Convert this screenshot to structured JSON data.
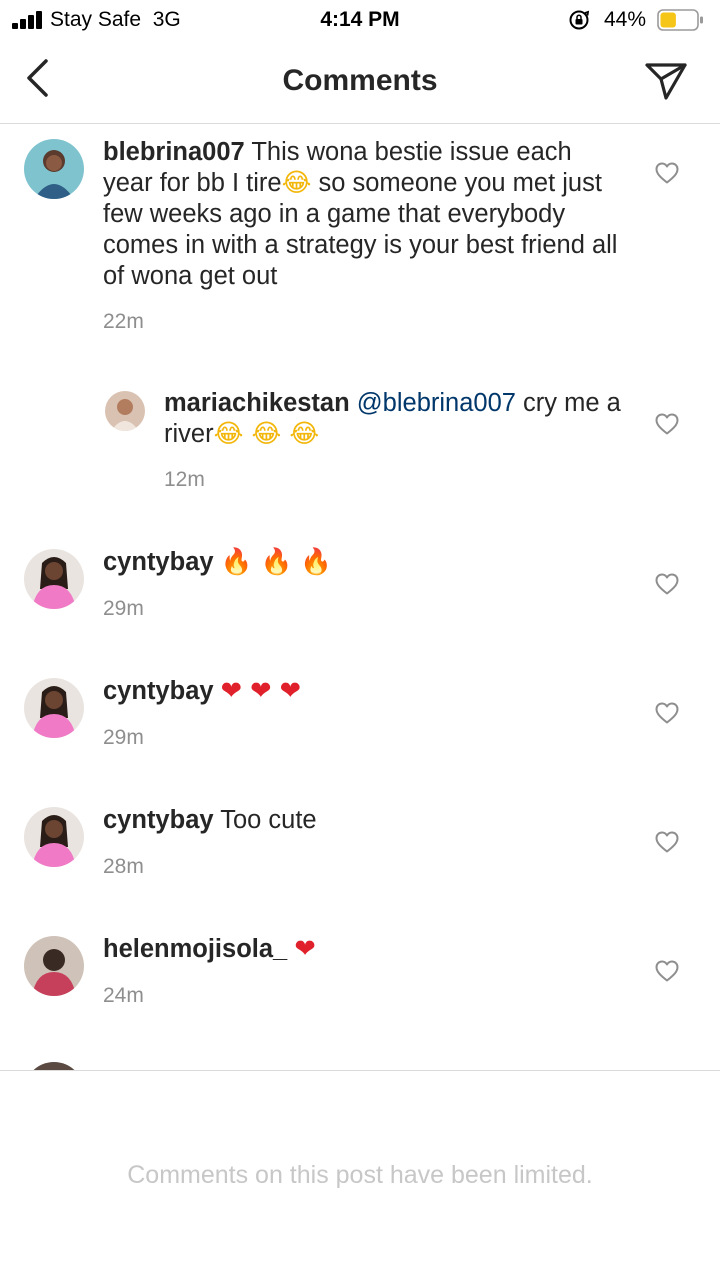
{
  "status_bar": {
    "carrier": "Stay Safe  3G",
    "time": "4:14 PM",
    "battery_percent": "44%",
    "battery_level": 0.44
  },
  "header": {
    "title": "Comments",
    "back_icon": "chevron-left-icon",
    "send_icon": "paper-plane-icon"
  },
  "comments": [
    {
      "username": "blebrina007",
      "text_1": "This wona bestie issue each year for bb I tire",
      "emoji_1": "😂",
      "text_2": " so someone you met just few weeks ago in a game that everybody comes in with a strategy is your best friend all of wona get out",
      "time": "22m"
    },
    {
      "username": "mariachikestan",
      "mention": "@blebrina007",
      "text_1": " cry me a river",
      "emojis": "😂 😂 😂",
      "time": "12m"
    },
    {
      "username": "cyntybay",
      "emojis": "🔥 🔥 🔥",
      "time": "29m"
    },
    {
      "username": "cyntybay",
      "emojis": "❤ ❤ ❤",
      "time": "29m"
    },
    {
      "username": "cyntybay",
      "text": "Too cute",
      "time": "28m"
    },
    {
      "username": "helenmojisola_",
      "emojis": "❤",
      "time": "24m"
    }
  ],
  "footer": {
    "note": "Comments on this post have been limited."
  },
  "colors": {
    "text": "#262626",
    "secondary": "#8e8e8e",
    "mention": "#00376b",
    "divider": "#dbdbdb",
    "battery": "#f5c518"
  }
}
